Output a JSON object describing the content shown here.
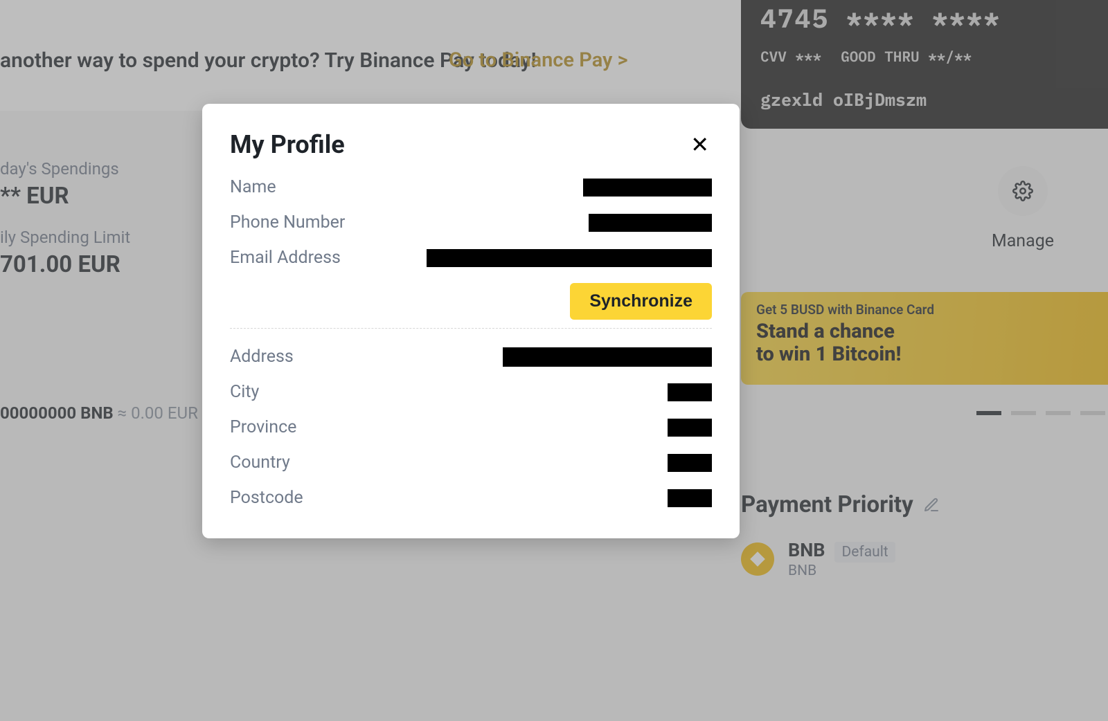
{
  "banner": {
    "text": "another way to spend your crypto? Try Binance Pay today!",
    "cta": "Go to Binance Pay >"
  },
  "spending": {
    "today_label": "day's Spendings",
    "today_value": "** EUR",
    "limit_label": "ily Spending Limit",
    "limit_value": "701.00 EUR"
  },
  "balance_line": {
    "bnb": "00000000 BNB",
    "eur": "≈ 0.00 EUR"
  },
  "card": {
    "number": "4745  ****  ****",
    "cvv_label": "CVV ***",
    "thru_label": "GOOD THRU **/**",
    "holder": "gzexld oIBjDmszm"
  },
  "manage": {
    "label": "Manage"
  },
  "promo": {
    "small": "Get 5 BUSD with Binance Card",
    "big_line1": "Stand a chance",
    "big_line2": "to win 1 Bitcoin!"
  },
  "priority": {
    "title": "Payment Priority",
    "items": [
      {
        "symbol": "BNB",
        "name": "BNB",
        "badge": "Default"
      }
    ]
  },
  "modal": {
    "title": "My Profile",
    "synchronize": "Synchronize",
    "fields": {
      "name": "Name",
      "phone": "Phone Number",
      "email": "Email Address",
      "address": "Address",
      "city": "City",
      "province": "Province",
      "country": "Country",
      "postcode": "Postcode"
    }
  }
}
